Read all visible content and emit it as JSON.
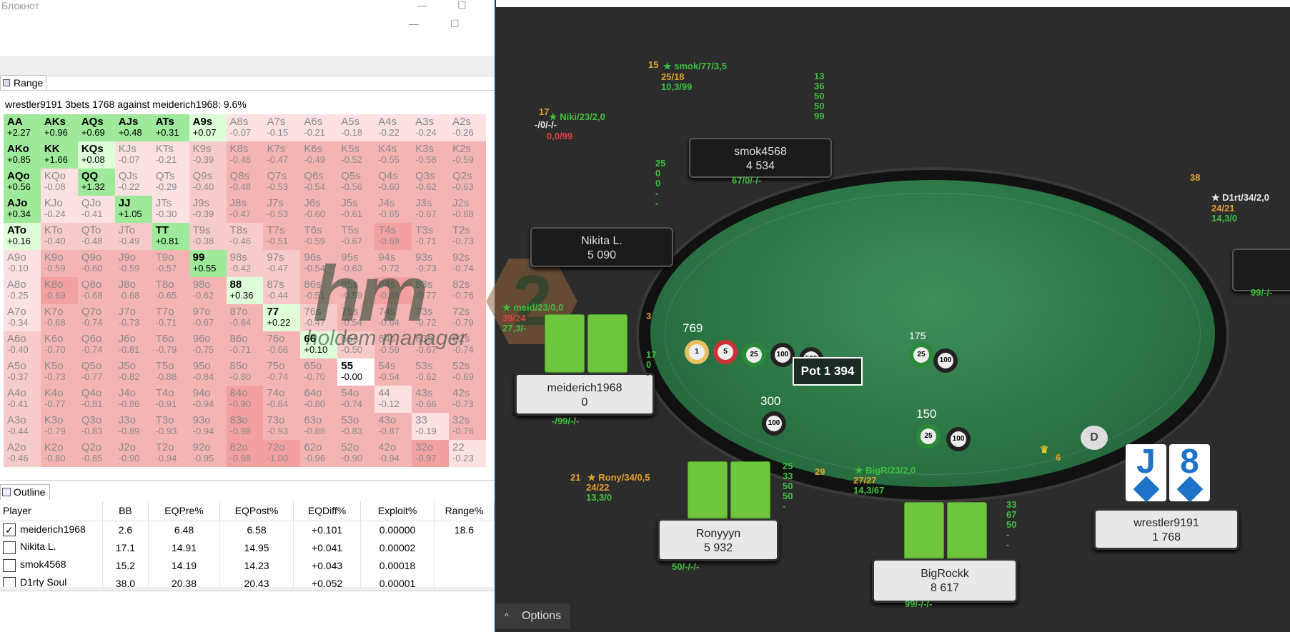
{
  "notepad": {
    "title": "Блокнот",
    "min": "—",
    "max": "☐"
  },
  "range": {
    "tab": "Range",
    "caption": "wrestler9191 3bets 1768 against meiderich1968: 9.6%",
    "rows": [
      [
        [
          "AA",
          "+2.27",
          "g"
        ],
        [
          "AKs",
          "+0.96",
          "g"
        ],
        [
          "AQs",
          "+0.69",
          "g"
        ],
        [
          "AJs",
          "+0.48",
          "g"
        ],
        [
          "ATs",
          "+0.31",
          "g"
        ],
        [
          "A9s",
          "+0.07",
          "lg"
        ],
        [
          "A8s",
          "-0.07",
          "p1"
        ],
        [
          "A7s",
          "-0.15",
          "p1"
        ],
        [
          "A6s",
          "-0.21",
          "p1"
        ],
        [
          "A5s",
          "-0.18",
          "p1"
        ],
        [
          "A4s",
          "-0.22",
          "p1"
        ],
        [
          "A3s",
          "-0.24",
          "p1"
        ],
        [
          "A2s",
          "-0.26",
          "p1"
        ]
      ],
      [
        [
          "AKo",
          "+0.85",
          "g"
        ],
        [
          "KK",
          "+1.66",
          "g"
        ],
        [
          "KQs",
          "+0.08",
          "lg"
        ],
        [
          "KJs",
          "-0.07",
          "p1"
        ],
        [
          "KTs",
          "-0.21",
          "p1"
        ],
        [
          "K9s",
          "-0.39",
          "p2"
        ],
        [
          "K8s",
          "-0.48",
          "p3"
        ],
        [
          "K7s",
          "-0.47",
          "p3"
        ],
        [
          "K6s",
          "-0.49",
          "p3"
        ],
        [
          "K5s",
          "-0.52",
          "p3"
        ],
        [
          "K4s",
          "-0.55",
          "p3"
        ],
        [
          "K3s",
          "-0.58",
          "p3"
        ],
        [
          "K2s",
          "-0.59",
          "p3"
        ]
      ],
      [
        [
          "AQo",
          "+0.56",
          "g"
        ],
        [
          "KQo",
          "-0.08",
          "p1"
        ],
        [
          "QQ",
          "+1.32",
          "g"
        ],
        [
          "QJs",
          "-0.22",
          "p1"
        ],
        [
          "QTs",
          "-0.29",
          "p1"
        ],
        [
          "Q9s",
          "-0.40",
          "p2"
        ],
        [
          "Q8s",
          "-0.48",
          "p3"
        ],
        [
          "Q7s",
          "-0.53",
          "p3"
        ],
        [
          "Q6s",
          "-0.54",
          "p3"
        ],
        [
          "Q5s",
          "-0.56",
          "p3"
        ],
        [
          "Q4s",
          "-0.60",
          "p3"
        ],
        [
          "Q3s",
          "-0.62",
          "p3"
        ],
        [
          "Q2s",
          "-0.63",
          "p3"
        ]
      ],
      [
        [
          "AJo",
          "+0.34",
          "g"
        ],
        [
          "KJo",
          "-0.24",
          "p1"
        ],
        [
          "QJo",
          "-0.41",
          "p1"
        ],
        [
          "JJ",
          "+1.05",
          "g"
        ],
        [
          "JTs",
          "-0.30",
          "p1"
        ],
        [
          "J9s",
          "-0.39",
          "p2"
        ],
        [
          "J8s",
          "-0.47",
          "p3"
        ],
        [
          "J7s",
          "-0.53",
          "p3"
        ],
        [
          "J6s",
          "-0.60",
          "p3"
        ],
        [
          "J5s",
          "-0.61",
          "p3"
        ],
        [
          "J4s",
          "-0.65",
          "p3"
        ],
        [
          "J3s",
          "-0.67",
          "p3"
        ],
        [
          "J2s",
          "-0.68",
          "p3"
        ]
      ],
      [
        [
          "ATo",
          "+0.16",
          "lg"
        ],
        [
          "KTo",
          "-0.40",
          "p2"
        ],
        [
          "QTo",
          "-0.48",
          "p2"
        ],
        [
          "JTo",
          "-0.49",
          "p2"
        ],
        [
          "TT",
          "+0.81",
          "g"
        ],
        [
          "T9s",
          "-0.38",
          "p2"
        ],
        [
          "T8s",
          "-0.46",
          "p2"
        ],
        [
          "T7s",
          "-0.51",
          "p3"
        ],
        [
          "T6s",
          "-0.59",
          "p3"
        ],
        [
          "T5s",
          "-0.67",
          "p3"
        ],
        [
          "T4s",
          "-0.69",
          "p4"
        ],
        [
          "T3s",
          "-0.71",
          "p3"
        ],
        [
          "T2s",
          "-0.73",
          "p3"
        ]
      ],
      [
        [
          "A9o",
          "-0.10",
          "p1"
        ],
        [
          "K9o",
          "-0.59",
          "p3"
        ],
        [
          "Q9o",
          "-0.60",
          "p3"
        ],
        [
          "J9o",
          "-0.59",
          "p3"
        ],
        [
          "T9o",
          "-0.57",
          "p3"
        ],
        [
          "99",
          "+0.55",
          "g"
        ],
        [
          "98s",
          "-0.42",
          "p2"
        ],
        [
          "97s",
          "-0.47",
          "p2"
        ],
        [
          "96s",
          "-0.54",
          "p3"
        ],
        [
          "95s",
          "-0.63",
          "p3"
        ],
        [
          "94s",
          "-0.72",
          "p3"
        ],
        [
          "93s",
          "-0.73",
          "p3"
        ],
        [
          "92s",
          "-0.74",
          "p3"
        ]
      ],
      [
        [
          "A8o",
          "-0.25",
          "p1"
        ],
        [
          "K8o",
          "-0.69",
          "p4"
        ],
        [
          "Q8o",
          "-0.68",
          "p3"
        ],
        [
          "J8o",
          "-0.68",
          "p3"
        ],
        [
          "T8o",
          "-0.65",
          "p3"
        ],
        [
          "98o",
          "-0.62",
          "p3"
        ],
        [
          "88",
          "+0.36",
          "lg"
        ],
        [
          "87s",
          "-0.44",
          "p2"
        ],
        [
          "86s",
          "-0.51",
          "p3"
        ],
        [
          "85s",
          "-0.59",
          "p3"
        ],
        [
          "84s",
          "-0.69",
          "p4"
        ],
        [
          "83s",
          "-0.77",
          "p3"
        ],
        [
          "82s",
          "-0.76",
          "p3"
        ]
      ],
      [
        [
          "A7o",
          "-0.34",
          "p1"
        ],
        [
          "K7o",
          "-0.68",
          "p3"
        ],
        [
          "Q7o",
          "-0.74",
          "p3"
        ],
        [
          "J7o",
          "-0.73",
          "p3"
        ],
        [
          "T7o",
          "-0.71",
          "p3"
        ],
        [
          "97o",
          "-0.67",
          "p3"
        ],
        [
          "87o",
          "-0.64",
          "p3"
        ],
        [
          "77",
          "+0.22",
          "lg"
        ],
        [
          "76s",
          "-0.47",
          "p2"
        ],
        [
          "75s",
          "-0.54",
          "p3"
        ],
        [
          "74s",
          "-0.64",
          "p3"
        ],
        [
          "73s",
          "-0.72",
          "p3"
        ],
        [
          "72s",
          "-0.79",
          "p3"
        ]
      ],
      [
        [
          "A6o",
          "-0.40",
          "p2"
        ],
        [
          "K6o",
          "-0.70",
          "p3"
        ],
        [
          "Q6o",
          "-0.74",
          "p3"
        ],
        [
          "J6o",
          "-0.81",
          "p3"
        ],
        [
          "T6o",
          "-0.79",
          "p3"
        ],
        [
          "96o",
          "-0.75",
          "p3"
        ],
        [
          "86o",
          "-0.71",
          "p3"
        ],
        [
          "76o",
          "-0.66",
          "p3"
        ],
        [
          "66",
          "+0.10",
          "lg"
        ],
        [
          "65s",
          "-0.50",
          "p2"
        ],
        [
          "64s",
          "-0.59",
          "p3"
        ],
        [
          "63s",
          "-0.67",
          "p3"
        ],
        [
          "62s",
          "-0.74",
          "p3"
        ]
      ],
      [
        [
          "A5o",
          "-0.37",
          "p2"
        ],
        [
          "K5o",
          "-0.73",
          "p3"
        ],
        [
          "Q5o",
          "-0.77",
          "p3"
        ],
        [
          "J5o",
          "-0.82",
          "p3"
        ],
        [
          "T5o",
          "-0.88",
          "p3"
        ],
        [
          "95o",
          "-0.84",
          "p3"
        ],
        [
          "85o",
          "-0.80",
          "p3"
        ],
        [
          "75o",
          "-0.74",
          "p3"
        ],
        [
          "65o",
          "-0.70",
          "p3"
        ],
        [
          "55",
          "-0.00",
          "w"
        ],
        [
          "54s",
          "-0.54",
          "p3"
        ],
        [
          "53s",
          "-0.62",
          "p3"
        ],
        [
          "52s",
          "-0.69",
          "p3"
        ]
      ],
      [
        [
          "A4o",
          "-0.41",
          "p2"
        ],
        [
          "K4o",
          "-0.77",
          "p3"
        ],
        [
          "Q4o",
          "-0.81",
          "p3"
        ],
        [
          "J4o",
          "-0.86",
          "p3"
        ],
        [
          "T4o",
          "-0.91",
          "p3"
        ],
        [
          "94o",
          "-0.94",
          "p3"
        ],
        [
          "84o",
          "-0.90",
          "p4"
        ],
        [
          "74o",
          "-0.84",
          "p3"
        ],
        [
          "64o",
          "-0.80",
          "p3"
        ],
        [
          "54o",
          "-0.74",
          "p3"
        ],
        [
          "44",
          "-0.12",
          "p1"
        ],
        [
          "43s",
          "-0.66",
          "p3"
        ],
        [
          "42s",
          "-0.73",
          "p3"
        ]
      ],
      [
        [
          "A3o",
          "-0.44",
          "p2"
        ],
        [
          "K3o",
          "-0.79",
          "p3"
        ],
        [
          "Q3o",
          "-0.83",
          "p3"
        ],
        [
          "J3o",
          "-0.89",
          "p3"
        ],
        [
          "T3o",
          "-0.93",
          "p3"
        ],
        [
          "93o",
          "-0.94",
          "p3"
        ],
        [
          "83o",
          "-0.98",
          "p4"
        ],
        [
          "73o",
          "-0.93",
          "p3"
        ],
        [
          "63o",
          "-0.88",
          "p3"
        ],
        [
          "53o",
          "-0.83",
          "p3"
        ],
        [
          "43o",
          "-0.87",
          "p3"
        ],
        [
          "33",
          "-0.19",
          "p1"
        ],
        [
          "32s",
          "-0.76",
          "p3"
        ]
      ],
      [
        [
          "A2o",
          "-0.46",
          "p2"
        ],
        [
          "K2o",
          "-0.80",
          "p3"
        ],
        [
          "Q2o",
          "-0.85",
          "p3"
        ],
        [
          "J2o",
          "-0.90",
          "p3"
        ],
        [
          "T2o",
          "-0.94",
          "p3"
        ],
        [
          "92o",
          "-0.95",
          "p3"
        ],
        [
          "82o",
          "-0.98",
          "p4"
        ],
        [
          "72o",
          "-1.00",
          "p4"
        ],
        [
          "62o",
          "-0.96",
          "p3"
        ],
        [
          "52o",
          "-0.90",
          "p3"
        ],
        [
          "42o",
          "-0.94",
          "p3"
        ],
        [
          "32o",
          "-0.97",
          "p4"
        ],
        [
          "22",
          "-0.23",
          "p1"
        ]
      ]
    ]
  },
  "outline": {
    "tab": "Outline",
    "headers": [
      "Player",
      "BB",
      "EQPre%",
      "EQPost%",
      "EQDiff%",
      "Exploit%",
      "Range%"
    ],
    "rows": [
      {
        "checked": true,
        "player": "meiderich1968",
        "bb": "2.6",
        "eqpre": "6.48",
        "eqpost": "6.58",
        "eqdiff": "+0.101",
        "exploit": "0.00000",
        "range": "18.6"
      },
      {
        "checked": false,
        "player": "Nikita L.",
        "bb": "17.1",
        "eqpre": "14.91",
        "eqpost": "14.95",
        "eqdiff": "+0.041",
        "exploit": "0.00002",
        "range": ""
      },
      {
        "checked": false,
        "player": "smok4568",
        "bb": "15.2",
        "eqpre": "14.19",
        "eqpost": "14.23",
        "eqdiff": "+0.043",
        "exploit": "0.00018",
        "range": ""
      },
      {
        "checked": false,
        "player": "D1rty Soul",
        "bb": "38.0",
        "eqpre": "20.38",
        "eqpost": "20.43",
        "eqdiff": "+0.052",
        "exploit": "0.00001",
        "range": ""
      }
    ]
  },
  "table": {
    "logo_main": "hm",
    "logo_num": "2",
    "logo_sub": "holdem manager",
    "pot": "Pot 1 394",
    "dealer": "D",
    "options": "Options",
    "options_caret": "^",
    "bets": {
      "meiderich": "769",
      "bigr": "175",
      "rony": "300",
      "bigrockk": "150"
    },
    "seats": {
      "smok": {
        "name": "smok4568",
        "stack": "4 534"
      },
      "nikita": {
        "name": "Nikita L.",
        "stack": "5 090"
      },
      "meiderich": {
        "name": "meiderich1968",
        "stack": "0"
      },
      "rony": {
        "name": "Ronyyyn",
        "stack": "5 932"
      },
      "bigrockk": {
        "name": "BigRockk",
        "stack": "8 617"
      },
      "wrestler": {
        "name": "wrestler9191",
        "stack": "1 768"
      }
    },
    "hero_cards": [
      "J",
      "8"
    ],
    "hud": {
      "smok_a": "15",
      "smok_b": "★ smok/77/3,5",
      "smok_c": "25/18",
      "smok_d": "10,3/99",
      "smok_col": "13\n36\n50\n50\n99",
      "smok_under": "67/0/-/-",
      "niki_a": "17",
      "niki_b": "★ Niki/23/2,0",
      "niki_c": "-/0/-/-",
      "niki_d": "0,0/99",
      "niki_col": "25\n0\n0\n-\n-",
      "d1rt_a": "38",
      "d1rt_b": "★ D1rt/34/2,0",
      "d1rt_c": "24/21",
      "d1rt_d": "14,3/0",
      "d1rt_under": "99/-/-",
      "meid_b": "★ meid/23/0,0",
      "meid_c": "39/24",
      "meid_d": "27,3/-",
      "meid_3": "3",
      "meid_col": "17\n0\n-",
      "meid_under": "-/99/-/-",
      "rony_a": "21",
      "rony_b": "★ Rony/34/0,5",
      "rony_c": "24/22",
      "rony_d": "13,3/0",
      "rony_col": "25\n33\n50\n50\n-",
      "rony_under": "50/-/-/-",
      "bigr_a": "29",
      "bigr_b": "★ BigR/23/2,0",
      "bigr_c": "27/27",
      "bigr_d": "14,3/67",
      "bigr_col": "33\n67\n50\n-\n-",
      "bigr_under": "99/-/-/-",
      "hero_6": "6"
    }
  }
}
